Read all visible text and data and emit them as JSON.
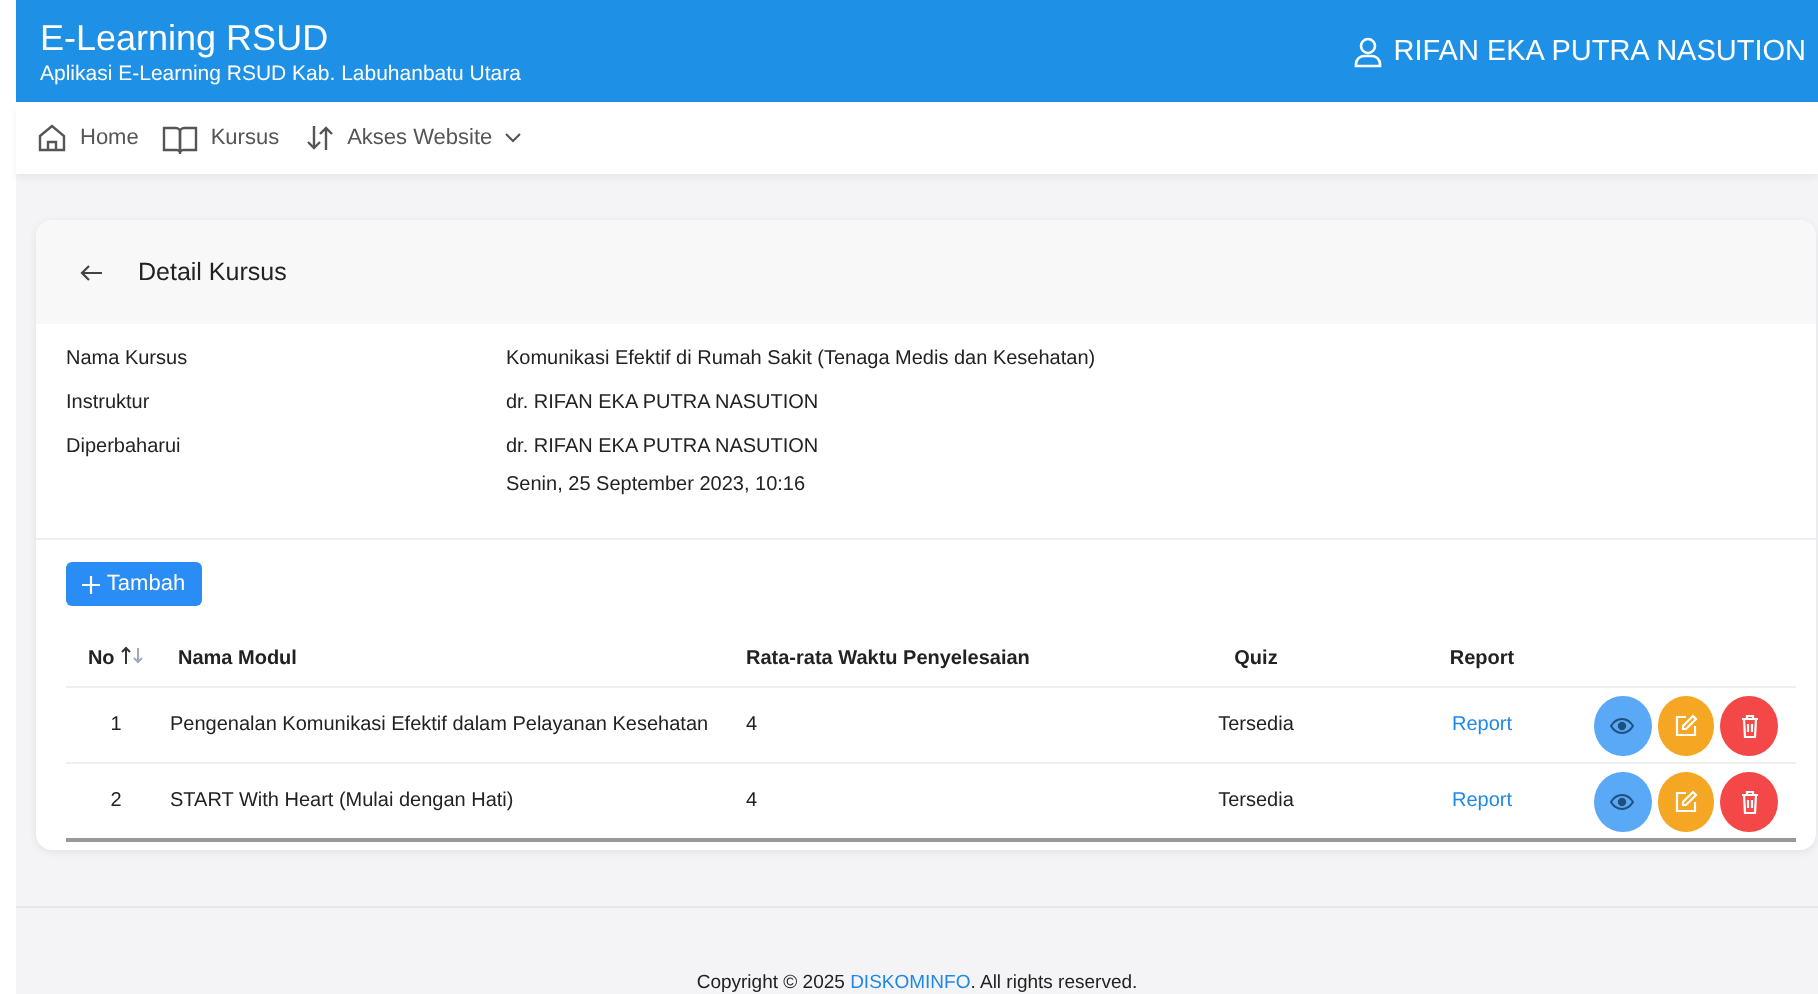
{
  "app": {
    "title": "E-Learning RSUD",
    "subtitle": "Aplikasi E-Learning RSUD Kab. Labuhanbatu Utara",
    "user": "RIFAN EKA PUTRA NASUTION"
  },
  "nav": [
    {
      "label": "Home",
      "kind": "home",
      "dropdown": false
    },
    {
      "label": "Kursus",
      "kind": "book",
      "dropdown": false
    },
    {
      "label": "Akses Website",
      "kind": "arrows",
      "dropdown": true
    }
  ],
  "card": {
    "title": "Detail Kursus",
    "details": [
      {
        "label": "Nama Kursus",
        "values": [
          "Komunikasi Efektif di Rumah Sakit (Tenaga Medis dan Kesehatan)"
        ]
      },
      {
        "label": "Instruktur",
        "values": [
          "dr. RIFAN EKA PUTRA NASUTION"
        ]
      },
      {
        "label": "Diperbaharui",
        "values": [
          "dr. RIFAN EKA PUTRA NASUTION",
          "Senin, 25 September 2023, 10:16"
        ]
      }
    ],
    "add_button": "Tambah"
  },
  "table": {
    "columns": [
      {
        "label": "No",
        "sortable": true
      },
      {
        "label": "Nama Modul",
        "sortable": false
      },
      {
        "label": "Rata-rata Waktu Penyelesaian",
        "sortable": false
      },
      {
        "label": "Quiz",
        "sortable": false
      },
      {
        "label": "Report",
        "sortable": false
      }
    ],
    "rows": [
      {
        "no": "1",
        "name": "Pengenalan Komunikasi Efektif dalam Pelayanan Kesehatan",
        "time": "4",
        "quiz": "Tersedia",
        "report": "Report"
      },
      {
        "no": "2",
        "name": "START With Heart (Mulai dengan Hati)",
        "time": "4",
        "quiz": "Tersedia",
        "report": "Report"
      }
    ]
  },
  "footer": {
    "before": "Copyright © 2025 ",
    "link": "DISKOMINFO",
    "after": ". All rights reserved."
  }
}
